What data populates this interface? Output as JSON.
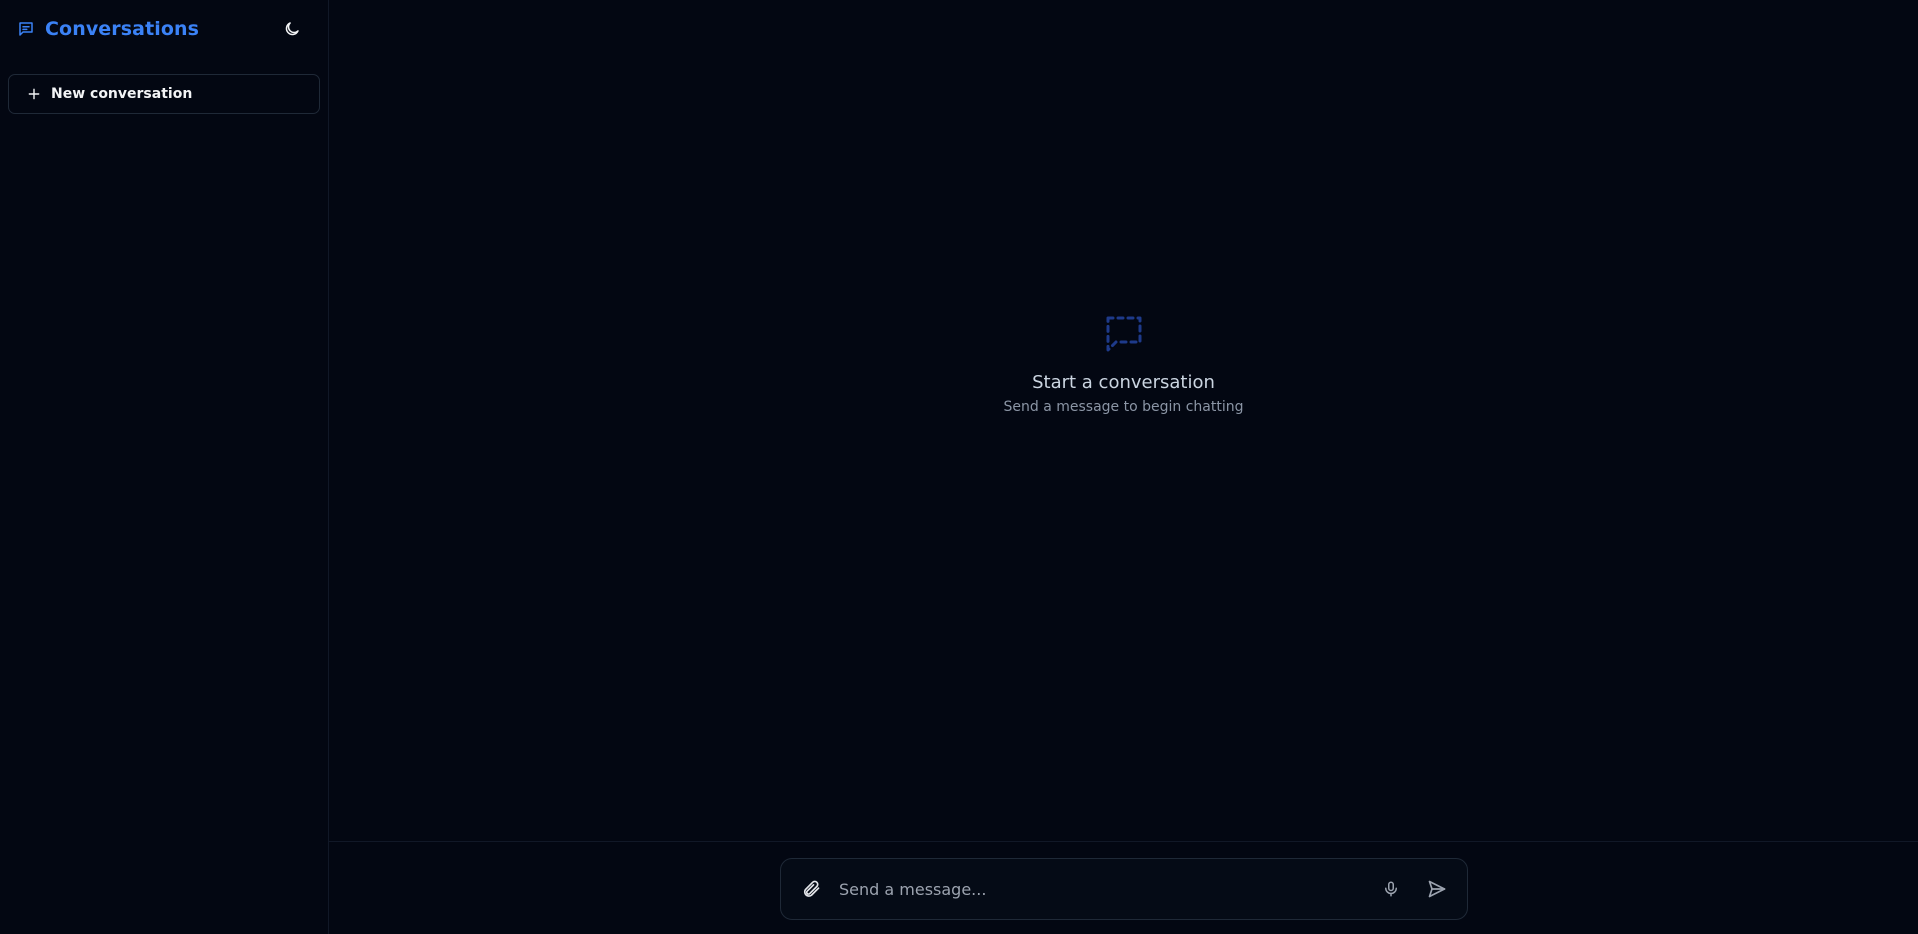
{
  "sidebar": {
    "title": "Conversations",
    "brand_icon": "message-square-icon",
    "theme_icon": "moon-icon",
    "new_conversation_label": "New conversation"
  },
  "main": {
    "empty_state": {
      "icon": "message-dashed-icon",
      "title": "Start a conversation",
      "subtitle": "Send a message to begin chatting"
    },
    "composer": {
      "placeholder": "Send a message...",
      "attach_icon": "paperclip-icon",
      "mic_icon": "microphone-icon",
      "send_icon": "send-icon"
    }
  },
  "colors": {
    "background": "#030712",
    "accent": "#3b82f6",
    "border": "#1f2937"
  }
}
